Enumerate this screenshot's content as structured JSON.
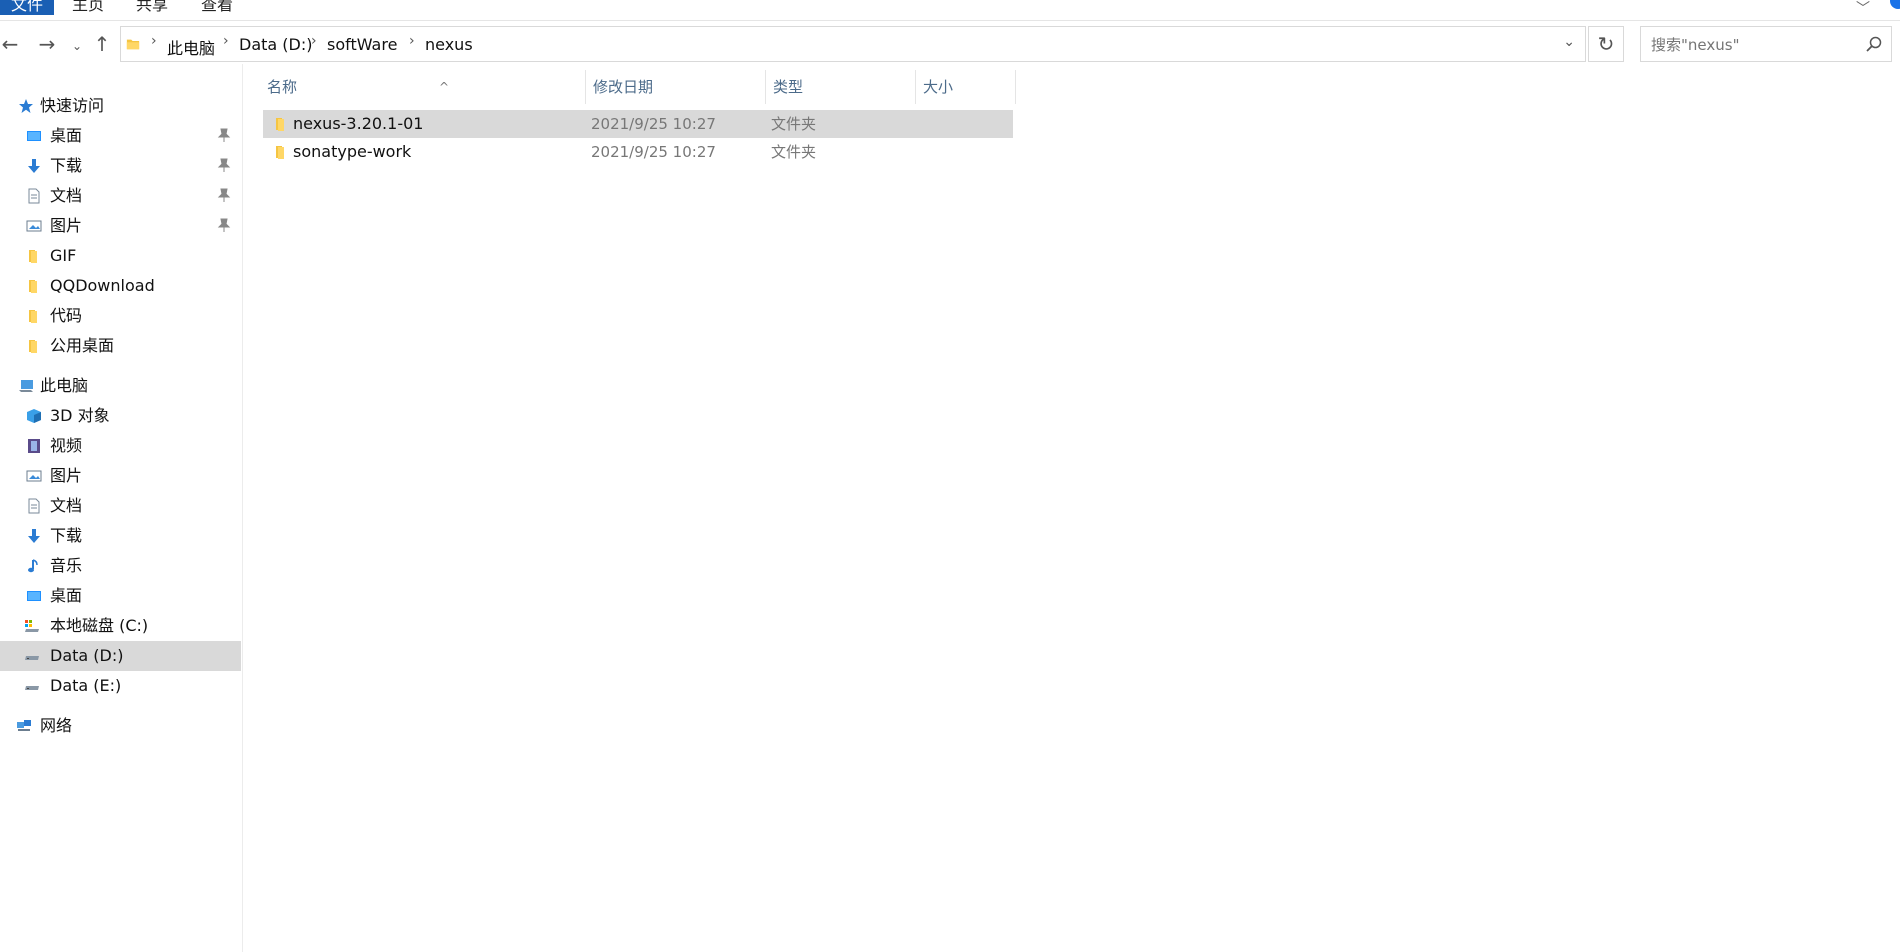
{
  "ribbon": {
    "tabs": [
      {
        "label": "文件"
      },
      {
        "label": "主页"
      },
      {
        "label": "共享"
      },
      {
        "label": "查看"
      }
    ]
  },
  "nav": {
    "breadcrumbs": [
      "此电脑",
      "Data (D:)",
      "softWare",
      "nexus"
    ],
    "search_placeholder": "搜索\"nexus\""
  },
  "sidebar": {
    "quick_access": {
      "label": "快速访问"
    },
    "quick_items": [
      {
        "label": "桌面",
        "icon": "desktop-icon",
        "pinned": true
      },
      {
        "label": "下载",
        "icon": "download-icon",
        "pinned": true
      },
      {
        "label": "文档",
        "icon": "document-icon",
        "pinned": true
      },
      {
        "label": "图片",
        "icon": "pictures-icon",
        "pinned": true
      },
      {
        "label": "GIF",
        "icon": "folder-icon",
        "pinned": false
      },
      {
        "label": "QQDownload",
        "icon": "folder-icon",
        "pinned": false
      },
      {
        "label": "代码",
        "icon": "folder-icon",
        "pinned": false
      },
      {
        "label": "公用桌面",
        "icon": "folder-icon",
        "pinned": false
      }
    ],
    "this_pc": {
      "label": "此电脑"
    },
    "pc_items": [
      {
        "label": "3D 对象",
        "icon": "3d-objects-icon"
      },
      {
        "label": "视频",
        "icon": "video-icon"
      },
      {
        "label": "图片",
        "icon": "pictures-icon"
      },
      {
        "label": "文档",
        "icon": "document-icon"
      },
      {
        "label": "下载",
        "icon": "download-icon"
      },
      {
        "label": "音乐",
        "icon": "music-icon"
      },
      {
        "label": "桌面",
        "icon": "desktop-icon"
      },
      {
        "label": "本地磁盘 (C:)",
        "icon": "system-drive-icon"
      },
      {
        "label": "Data (D:)",
        "icon": "drive-icon",
        "selected": true
      },
      {
        "label": "Data (E:)",
        "icon": "drive-icon"
      }
    ],
    "network": {
      "label": "网络"
    }
  },
  "columns": [
    {
      "label": "名称"
    },
    {
      "label": "修改日期"
    },
    {
      "label": "类型"
    },
    {
      "label": "大小"
    }
  ],
  "files": [
    {
      "name": "nexus-3.20.1-01",
      "date": "2021/9/25 10:27",
      "type": "文件夹",
      "selected": true
    },
    {
      "name": "sonatype-work",
      "date": "2021/9/25 10:27",
      "type": "文件夹",
      "selected": false
    }
  ],
  "colors": {
    "file_tab": "#1a5fb4",
    "selection": "#d9d9d9",
    "folder": "#f5c542",
    "header_text": "#4c6b8a"
  }
}
